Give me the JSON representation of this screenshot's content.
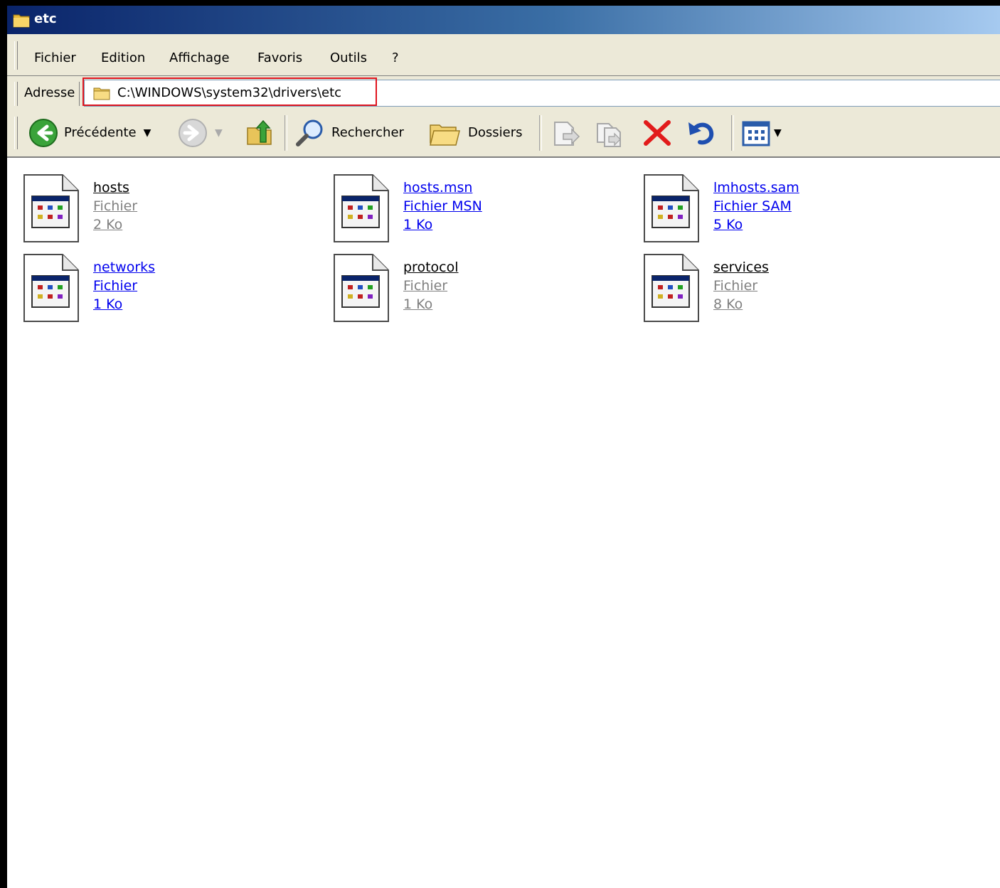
{
  "window": {
    "title": "etc"
  },
  "menu": [
    "Fichier",
    "Edition",
    "Affichage",
    "Favoris",
    "Outils",
    "?"
  ],
  "address": {
    "label": "Adresse",
    "value": "C:\\WINDOWS\\system32\\drivers\\etc"
  },
  "toolbar": {
    "back_label": "Précédente",
    "search_label": "Rechercher",
    "folders_label": "Dossiers"
  },
  "files": [
    {
      "name": "hosts",
      "type": "Fichier",
      "size": "2 Ko",
      "link": false
    },
    {
      "name": "hosts.msn",
      "type": "Fichier MSN",
      "size": "1 Ko",
      "link": true
    },
    {
      "name": "lmhosts.sam",
      "type": "Fichier SAM",
      "size": "5 Ko",
      "link": true
    },
    {
      "name": "networks",
      "type": "Fichier",
      "size": "1 Ko",
      "link": true
    },
    {
      "name": "protocol",
      "type": "Fichier",
      "size": "1 Ko",
      "link": false
    },
    {
      "name": "services",
      "type": "Fichier",
      "size": "8 Ko",
      "link": false
    }
  ],
  "colors": {
    "highlight": "#e0141e",
    "link": "#0000ee",
    "titlebar": "#0a246a"
  },
  "icons": [
    "folder-icon",
    "back-arrow-icon",
    "forward-arrow-icon",
    "up-folder-icon",
    "search-icon",
    "folders-icon",
    "move-to-icon",
    "copy-to-icon",
    "delete-icon",
    "undo-icon",
    "views-icon",
    "file-icon"
  ]
}
